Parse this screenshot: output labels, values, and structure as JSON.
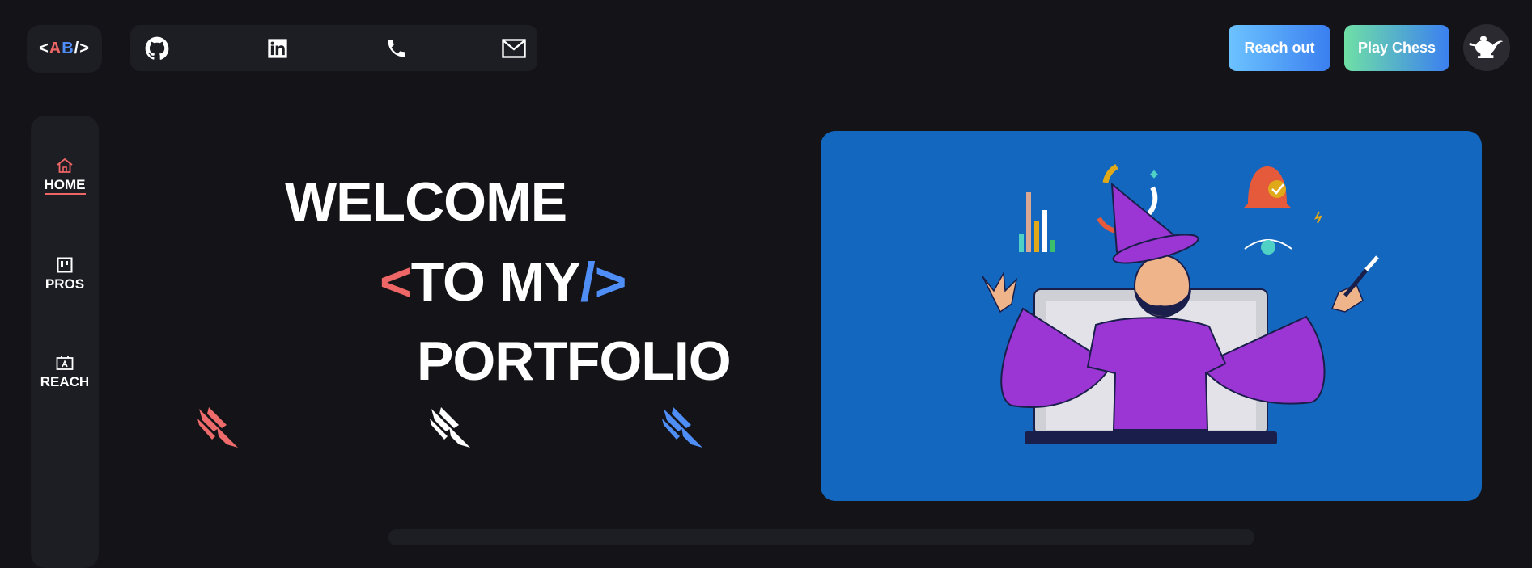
{
  "logo": {
    "lt": "<",
    "a": "A",
    "b": "B",
    "slash": "/",
    "gt": ">"
  },
  "social": [
    {
      "icon": "github-icon"
    },
    {
      "icon": "linkedin-icon"
    },
    {
      "icon": "phone-icon"
    },
    {
      "icon": "mail-icon"
    }
  ],
  "header": {
    "reach_out_label": "Reach out",
    "play_chess_label": "Play Chess",
    "lamp_icon": "magic-lamp-icon"
  },
  "nav": {
    "items": [
      {
        "label": "HOME",
        "icon": "home-icon",
        "active": true
      },
      {
        "label": "PROS",
        "icon": "kanban-icon",
        "active": false
      },
      {
        "label": "REACH",
        "icon": "contact-card-icon",
        "active": false
      }
    ]
  },
  "hero": {
    "line1": "WELCOME",
    "line2_lt": "<",
    "line2_text": "TO MY",
    "line2_slash": "/",
    "line2_gt": ">",
    "line3": "PORTFOLIO"
  },
  "colors": {
    "background": "#141418",
    "panel": "#1d1d24",
    "accent_red": "#ee6666",
    "accent_blue": "#4f8ef7",
    "hero_blue": "#1467bf",
    "wizard_purple": "#9b35d3"
  }
}
